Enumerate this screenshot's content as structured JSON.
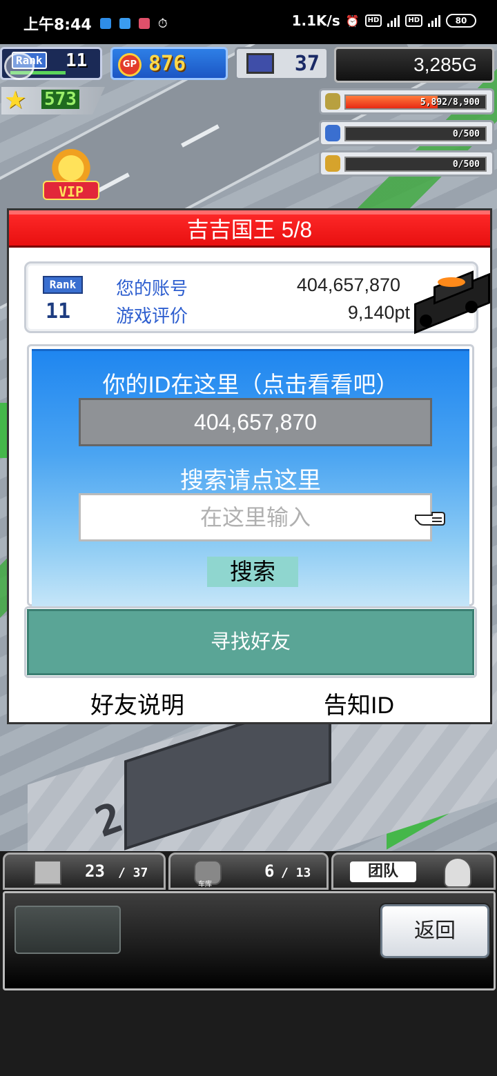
{
  "status_bar": {
    "time": "上午8:44",
    "network_speed": "1.1K/s",
    "battery": "80",
    "hd_badge": "HD",
    "net_type": "4G"
  },
  "hud": {
    "rank_label": "Rank",
    "rank_value": "11",
    "gp_label": "GP",
    "gp_value": "876",
    "pc_value": "37",
    "money": "3,285G",
    "star_value": "573",
    "resource_1": "5,892/8,900",
    "resource_2": "0/500",
    "resource_3": "0/500",
    "resource_1_fraction": 0.66,
    "vip_label": "VIP"
  },
  "dialog": {
    "title": "吉吉国王 5/8",
    "rank_label": "Rank",
    "rank_value": "11",
    "account_label": "您的账号",
    "account_value": "404,657,870",
    "rating_label": "游戏评价",
    "rating_value": "9,140pt",
    "id_prompt": "你的ID在这里（点击看看吧）",
    "id_value": "404,657,870",
    "search_prompt": "搜索请点这里",
    "search_placeholder": "在这里输入",
    "search_button": "搜索",
    "find_friend_button": "寻找好友",
    "friend_help_link": "好友说明",
    "share_id_link": "告知ID"
  },
  "bottom": {
    "tab_1_value": "23",
    "tab_1_max": "/ 37",
    "tab_2_sub": "车库",
    "tab_2_value": "6",
    "tab_2_max": "/ 13",
    "team_label": "团队",
    "back_button": "返回"
  },
  "colors": {
    "header_red": "#e81010",
    "panel_blue": "#1f86f0",
    "find_button_green": "#5aa596",
    "label_blue": "#2d5ecf"
  }
}
